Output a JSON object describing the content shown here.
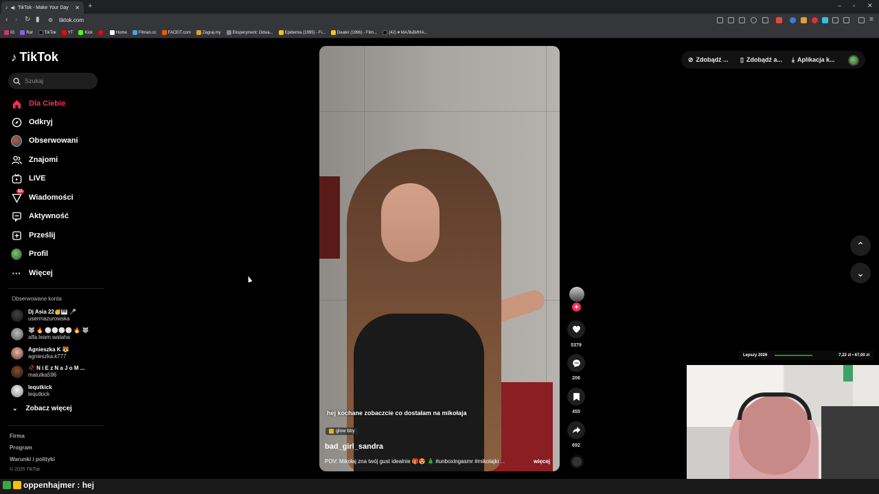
{
  "browser": {
    "tab_title": "TikTok - Make Your Day",
    "url": "tiktok.com",
    "bookmarks": [
      {
        "label": "IG",
        "color": "#d6336c"
      },
      {
        "label": "Rat",
        "color": "#8a5cf6"
      },
      {
        "label": "TikTok",
        "color": "#111111"
      },
      {
        "label": "YT",
        "color": "#ff0000"
      },
      {
        "label": "Kick",
        "color": "#53fc18"
      },
      {
        "label": "",
        "color": "#ff0000"
      },
      {
        "label": "Home",
        "color": "#ffffff"
      },
      {
        "label": "Filman.cc",
        "color": "#4aa3df"
      },
      {
        "label": "FACEIT.com",
        "color": "#ff5500"
      },
      {
        "label": "Zagraj.my",
        "color": "#e0a030"
      },
      {
        "label": "Eksperyment: Odsia...",
        "color": "#888888"
      },
      {
        "label": "Epidemia (1995) - Fi...",
        "color": "#f5c518"
      },
      {
        "label": "Dealer (1996) - Film...",
        "color": "#f5c518"
      },
      {
        "label": "(42) ♥ МАЛЬВИНА...",
        "color": "#111111"
      }
    ]
  },
  "sidebar": {
    "logo": "TikTok",
    "search_placeholder": "Szukaj",
    "nav": [
      {
        "label": "Dla Ciebie",
        "icon": "home-icon"
      },
      {
        "label": "Odkryj",
        "icon": "compass-icon"
      },
      {
        "label": "Obserwowani",
        "icon": "following-avatar-icon"
      },
      {
        "label": "Znajomi",
        "icon": "friends-icon"
      },
      {
        "label": "LIVE",
        "icon": "live-icon"
      },
      {
        "label": "Wiadomości",
        "icon": "inbox-icon",
        "badge": "53"
      },
      {
        "label": "Aktywność",
        "icon": "activity-icon"
      },
      {
        "label": "Prześlij",
        "icon": "upload-icon"
      },
      {
        "label": "Profil",
        "icon": "profile-icon"
      },
      {
        "label": "Więcej",
        "icon": "more-icon"
      }
    ],
    "followed_title": "Obserwowane konta",
    "accounts": [
      {
        "name": "Dj Asia 22🥳🎹 🎤",
        "handle": "usermazurowska"
      },
      {
        "name": "🐺 🔥 ⚪⚪⚪⚪ 🔥 🐺",
        "handle": "alfa.team.wataha"
      },
      {
        "name": "Agnieszka K 🐯",
        "handle": "agnieszka.k777"
      },
      {
        "name": "🥀 N i E z N a J o M ...",
        "handle": "malutka596"
      },
      {
        "name": "lequtkick",
        "handle": "lequtkick"
      }
    ],
    "see_more": "Zobacz więcej",
    "footer": [
      "Firma",
      "Program",
      "Warunki i polityki"
    ],
    "copyright": "© 2025 TikTok"
  },
  "top_actions": [
    {
      "label": "Zdobądź ...",
      "icon": "coin-icon"
    },
    {
      "label": "Zdobądź a...",
      "icon": "phone-icon"
    },
    {
      "label": "Aplikacja k...",
      "icon": "download-icon"
    }
  ],
  "video": {
    "caption": "hej kochane zobaczcie co dostałam na mikołaja",
    "chip": "glow bby",
    "author": "bad_girl_sandra",
    "description": "POV: Mikołaj zna twój gust idealnie 🎁😍 🎄 #unboxingasmr #mikolajki ...",
    "more": "więcej",
    "likes": "5379",
    "comments": "206",
    "saves": "455",
    "shares": "692"
  },
  "overlay": {
    "ticker_label": "Lepszy 2026",
    "ticker_value": "7,22 zł • 67,00 zł",
    "chat_user": "oppenhajmer",
    "chat_message": ": hej"
  }
}
